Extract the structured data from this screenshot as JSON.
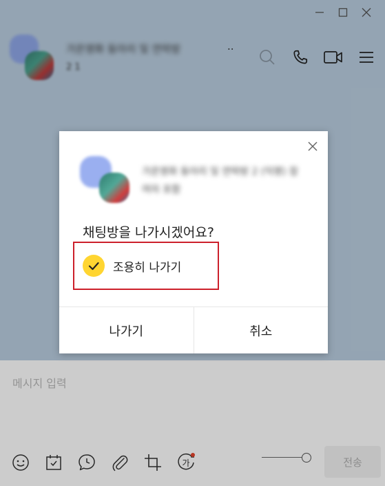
{
  "window": {
    "minimize_icon": "minimize-icon",
    "maximize_icon": "maximize-icon",
    "close_icon": "close-icon"
  },
  "chat": {
    "title_obscured": "가온영화 동아리 및 연락방",
    "title_more": "..",
    "members_obscured": "2 1",
    "icons": [
      "search-icon",
      "phone-icon",
      "video-icon",
      "menu-icon"
    ]
  },
  "input": {
    "placeholder": "메시지 입력",
    "send_label": "전송",
    "tools": [
      "emoji-icon",
      "calendar-icon",
      "schedule-icon",
      "attach-icon",
      "crop-icon",
      "translate-icon"
    ],
    "translate_glyph": "가",
    "notification_color": "#e5432b"
  },
  "dialog": {
    "chat_name_obscured": "가온영화 동아리 및 연락방 2 (익명) 참여자 포함",
    "question": "채팅방을 나가시겠어요?",
    "quiet_leave_label": "조용히 나가기",
    "quiet_leave_checked": true,
    "leave_button": "나가기",
    "cancel_button": "취소",
    "check_color": "#ffd531",
    "highlight_color": "#cc1f2a"
  }
}
